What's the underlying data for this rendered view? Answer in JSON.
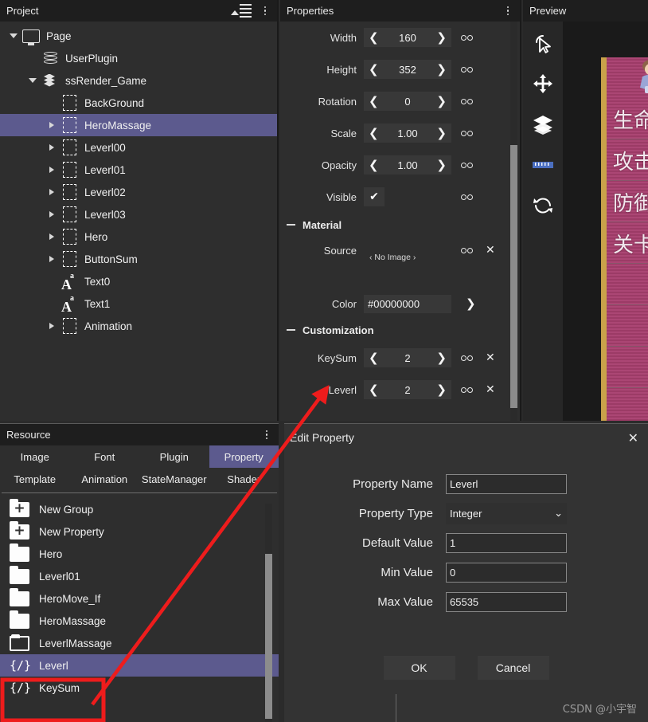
{
  "project": {
    "title": "Project",
    "tree": [
      {
        "label": "Page",
        "icon": "monitor-icon",
        "indent": 0,
        "caret": "down",
        "selected": false
      },
      {
        "label": "UserPlugin",
        "icon": "database-icon",
        "indent": 1,
        "caret": "none",
        "selected": false
      },
      {
        "label": "ssRender_Game",
        "icon": "layers-icon",
        "indent": 1,
        "caret": "down",
        "selected": false
      },
      {
        "label": "BackGround",
        "icon": "dashed-box-icon",
        "indent": 2,
        "caret": "none",
        "selected": false
      },
      {
        "label": "HeroMassage",
        "icon": "dashed-box-icon",
        "indent": 2,
        "caret": "right",
        "selected": true
      },
      {
        "label": "Leverl00",
        "icon": "dashed-box-icon",
        "indent": 2,
        "caret": "right",
        "selected": false
      },
      {
        "label": "Leverl01",
        "icon": "dashed-box-icon",
        "indent": 2,
        "caret": "right",
        "selected": false
      },
      {
        "label": "Leverl02",
        "icon": "dashed-box-icon",
        "indent": 2,
        "caret": "right",
        "selected": false
      },
      {
        "label": "Leverl03",
        "icon": "dashed-box-icon",
        "indent": 2,
        "caret": "right",
        "selected": false
      },
      {
        "label": "Hero",
        "icon": "dashed-box-icon",
        "indent": 2,
        "caret": "right",
        "selected": false
      },
      {
        "label": "ButtonSum",
        "icon": "dashed-box-icon",
        "indent": 2,
        "caret": "right",
        "selected": false
      },
      {
        "label": "Text0",
        "icon": "text-icon",
        "indent": 2,
        "caret": "none",
        "selected": false
      },
      {
        "label": "Text1",
        "icon": "text-icon",
        "indent": 2,
        "caret": "none",
        "selected": false
      },
      {
        "label": "Animation",
        "icon": "dashed-box-icon",
        "indent": 2,
        "caret": "right",
        "selected": false
      }
    ]
  },
  "properties": {
    "title": "Properties",
    "rows": [
      {
        "label": "Width",
        "value": "160",
        "type": "spinner",
        "link": true,
        "clear": false
      },
      {
        "label": "Height",
        "value": "352",
        "type": "spinner",
        "link": true,
        "clear": false
      },
      {
        "label": "Rotation",
        "value": "0",
        "type": "spinner",
        "link": true,
        "clear": false
      },
      {
        "label": "Scale",
        "value": "1.00",
        "type": "spinner",
        "link": true,
        "clear": false
      },
      {
        "label": "Opacity",
        "value": "1.00",
        "type": "spinner",
        "link": true,
        "clear": false
      },
      {
        "label": "Visible",
        "value": "✔",
        "type": "checkbox",
        "link": true,
        "clear": false
      }
    ],
    "material": {
      "title": "Material",
      "source_label": "Source",
      "source_value": "‹ No Image ›",
      "color_label": "Color",
      "color_value": "#00000000"
    },
    "customization": {
      "title": "Customization",
      "rows": [
        {
          "label": "KeySum",
          "value": "2",
          "link": true,
          "clear": true
        },
        {
          "label": "Leverl",
          "value": "2",
          "link": true,
          "clear": true
        }
      ]
    }
  },
  "preview": {
    "title": "Preview",
    "tools": [
      {
        "name": "select-cursor-icon"
      },
      {
        "name": "move-icon"
      },
      {
        "name": "layers-icon"
      },
      {
        "name": "ruler-icon"
      },
      {
        "name": "refresh-icon"
      }
    ],
    "art_rows": [
      "生命",
      "攻击",
      "防御",
      "关卡"
    ]
  },
  "resource": {
    "title": "Resource",
    "tabs_row1": [
      {
        "label": "Image",
        "active": false
      },
      {
        "label": "Font",
        "active": false
      },
      {
        "label": "Plugin",
        "active": false
      },
      {
        "label": "Property",
        "active": true
      }
    ],
    "tabs_row2": [
      {
        "label": "Template",
        "active": false
      },
      {
        "label": "Animation",
        "active": false
      },
      {
        "label": "StateManager",
        "active": false
      },
      {
        "label": "Shader",
        "active": false
      }
    ],
    "items": [
      {
        "label": "New Group",
        "icon": "folder-plus-icon",
        "selected": false
      },
      {
        "label": "New Property",
        "icon": "folder-plus-icon",
        "selected": false
      },
      {
        "label": "Hero",
        "icon": "folder-icon",
        "selected": false
      },
      {
        "label": "Leverl01",
        "icon": "folder-icon",
        "selected": false
      },
      {
        "label": "HeroMove_If",
        "icon": "folder-icon",
        "selected": false
      },
      {
        "label": "HeroMassage",
        "icon": "folder-icon",
        "selected": false
      },
      {
        "label": "LeverlMassage",
        "icon": "folder-open-icon",
        "selected": false
      },
      {
        "label": "Leverl",
        "icon": "code-brace-icon",
        "selected": true
      },
      {
        "label": "KeySum",
        "icon": "code-brace-icon",
        "selected": false
      }
    ]
  },
  "edit_dialog": {
    "title": "Edit Property",
    "close_label": "✕",
    "fields": [
      {
        "label": "Property Name",
        "value": "Leverl",
        "type": "text"
      },
      {
        "label": "Property Type",
        "value": "Integer",
        "type": "select"
      },
      {
        "label": "Default Value",
        "value": "1",
        "type": "text"
      },
      {
        "label": "Min Value",
        "value": "0",
        "type": "text"
      },
      {
        "label": "Max Value",
        "value": "65535",
        "type": "text"
      }
    ],
    "ok_label": "OK",
    "cancel_label": "Cancel"
  },
  "watermark": "CSDN @小宇智",
  "colors": {
    "selection": "#5c5a8e",
    "panel_bg": "#2e2e2e",
    "title_bg": "#1e1e1e",
    "annotation_red": "#ee1c1c"
  }
}
